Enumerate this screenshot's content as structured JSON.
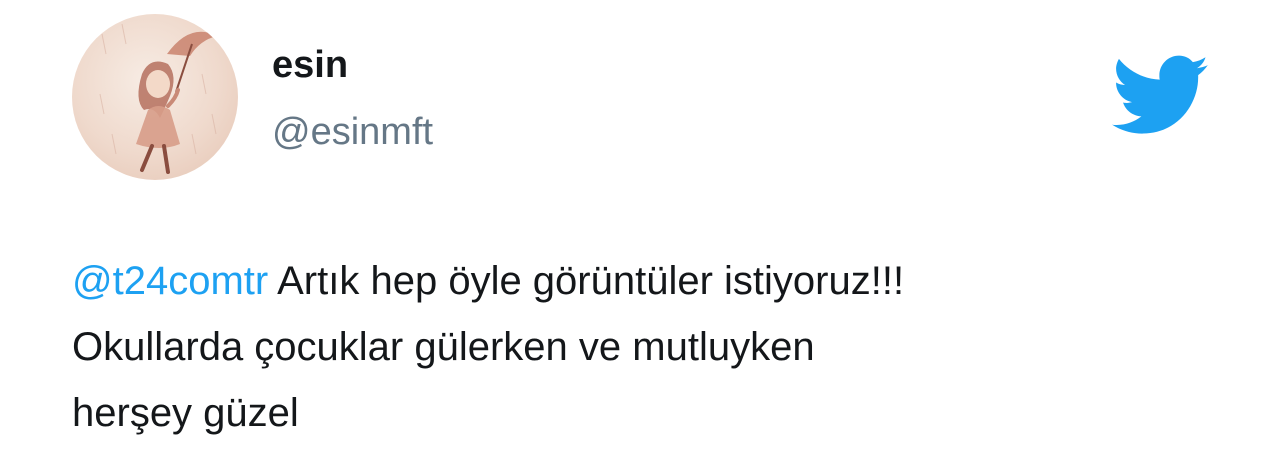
{
  "author": {
    "display_name": "esin",
    "handle": "@esinmft",
    "avatar_icon": "avatar-girl-with-umbrella"
  },
  "brand": {
    "icon": "twitter-bird-icon",
    "color": "#1da1f2"
  },
  "tweet": {
    "mention": "@t24comtr",
    "line1_rest": " Artık hep öyle görüntüler istiyoruz!!!",
    "line2": "Okullarda çocuklar gülerken ve mutluyken",
    "line3": "herşey güzel"
  },
  "colors": {
    "text": "#14171a",
    "secondary": "#657786",
    "link": "#1da1f2"
  }
}
